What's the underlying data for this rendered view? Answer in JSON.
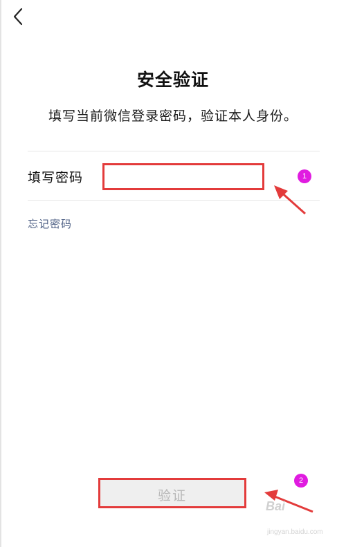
{
  "header": {
    "back_icon": "chevron-left-icon",
    "title": "安全验证",
    "subtitle": "填写当前微信登录密码，验证本人身份。"
  },
  "form": {
    "password_label": "填写密码",
    "password_value": "",
    "forgot_link": "忘记密码"
  },
  "actions": {
    "verify_label": "验证",
    "verify_enabled": false
  },
  "annotations": {
    "marker_1": "1",
    "marker_2": "2",
    "highlight_color": "#e33b3b",
    "marker_color": "#e01ce0"
  },
  "watermark": {
    "brand": "Bai",
    "sub": "jingyan.baidu.com"
  }
}
